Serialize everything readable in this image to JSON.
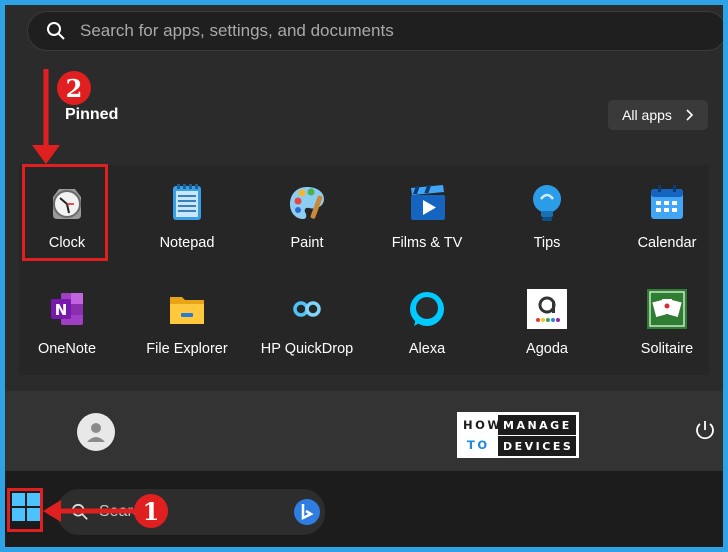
{
  "search": {
    "placeholder": "Search for apps, settings, and documents"
  },
  "pinned": {
    "title": "Pinned",
    "all_apps_label": "All apps",
    "apps": [
      {
        "label": "Clock",
        "icon": "clock-icon"
      },
      {
        "label": "Notepad",
        "icon": "notepad-icon"
      },
      {
        "label": "Paint",
        "icon": "paint-palette-icon"
      },
      {
        "label": "Films & TV",
        "icon": "film-icon"
      },
      {
        "label": "Tips",
        "icon": "lightbulb-icon"
      },
      {
        "label": "Calendar",
        "icon": "calendar-icon"
      },
      {
        "label": "OneNote",
        "icon": "onenote-icon"
      },
      {
        "label": "File Explorer",
        "icon": "folder-icon"
      },
      {
        "label": "HP QuickDrop",
        "icon": "quickdrop-icon"
      },
      {
        "label": "Alexa",
        "icon": "alexa-icon"
      },
      {
        "label": "Agoda",
        "icon": "agoda-icon"
      },
      {
        "label": "Solitaire",
        "icon": "cards-icon"
      }
    ]
  },
  "logo": {
    "line1": "HOW",
    "line2": "TO",
    "word1": "MANAGE",
    "word2": "DEVICES"
  },
  "taskbar": {
    "search_label": "Search"
  },
  "annotations": {
    "step1": "1",
    "step2": "2",
    "highlight_color": "#e02020"
  },
  "colors": {
    "frame_border": "#2da3e6",
    "accent": "#0078d4"
  }
}
